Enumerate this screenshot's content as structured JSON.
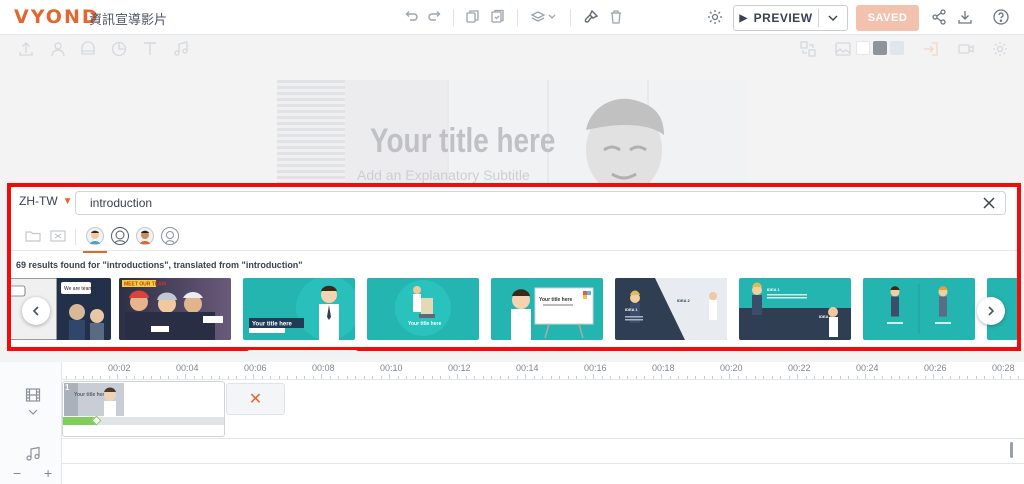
{
  "app": {
    "logo": "VYOND",
    "project_title": "資訊宣導影片"
  },
  "header": {
    "preview_label": "PREVIEW",
    "saved_label": "SAVED"
  },
  "stage": {
    "title_text": "Your title here",
    "subtitle_text": "Add an Explanatory Subtitle",
    "swatch_colors": [
      "#ffffff",
      "#333d4b",
      "#c8d1e0"
    ]
  },
  "search": {
    "language": "ZH-TW",
    "query": "introduction",
    "results_text": "69 results found for \"introductions\", translated from \"introduction\"",
    "filters": [
      "folder-icon",
      "image-icon",
      "character-icon",
      "character-outline-icon",
      "character-alt-icon",
      "character-line-icon"
    ]
  },
  "thumbnails": [
    {
      "name": "meet-the-team-comic",
      "text": ""
    },
    {
      "name": "meet-our-team",
      "text": "MEET OUR TEAM"
    },
    {
      "name": "title-with-character",
      "text": "Your title here"
    },
    {
      "name": "podium-title",
      "text": "Your title here"
    },
    {
      "name": "whiteboard-title",
      "text": "Your title here"
    },
    {
      "name": "idea-slides",
      "text": "IDEA 1"
    },
    {
      "name": "idea-dark-slides",
      "text": "IDEA 1"
    },
    {
      "name": "two-characters",
      "text": ""
    }
  ],
  "timeline": {
    "ticks": [
      "00:02",
      "00:04",
      "00:06",
      "00:08",
      "00:10",
      "00:12",
      "00:14",
      "00:16",
      "00:18",
      "00:20",
      "00:22",
      "00:24",
      "00:26",
      "00:28"
    ],
    "scene_number": "1",
    "zoom_out": "−",
    "zoom_in": "+",
    "add_scene_symbol": "✕"
  }
}
